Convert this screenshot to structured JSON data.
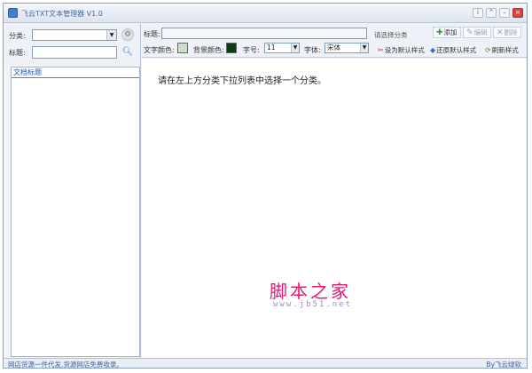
{
  "window": {
    "title": "飞云TXT文本管理器 V1.0",
    "controls": [
      "i",
      "^",
      "–",
      "×"
    ]
  },
  "left_panel": {
    "category_label": "分类:",
    "category_value": "",
    "title_label": "标题:",
    "title_value": "",
    "settings_icon": "gear-icon",
    "search_icon": "search-icon",
    "list_header": "文档标题",
    "items": []
  },
  "toolbar": {
    "title_label": "标题:",
    "title_value": "",
    "hint": "请选择分类",
    "add_label": "添加",
    "edit_label": "编辑",
    "delete_label": "删除",
    "text_color_label": "文字颜色:",
    "text_color": "#c9dfc7",
    "bg_color_label": "背景颜色:",
    "bg_color": "#0d3b14",
    "font_size_label": "字号:",
    "font_size_value": "11",
    "font_label": "字体:",
    "font_value": "宋体",
    "set_default_label": "设为默认样式",
    "restore_default_label": "还原默认样式",
    "refresh_label": "刷新样式"
  },
  "content": {
    "message": "请在左上方分类下拉列表中选择一个分类。"
  },
  "watermark": {
    "line1": "脚本之家",
    "line2": "www.jb51.net"
  },
  "status": {
    "left": "网店货源一件代发,货源网店免费收录。",
    "right": "By飞云绿软"
  }
}
